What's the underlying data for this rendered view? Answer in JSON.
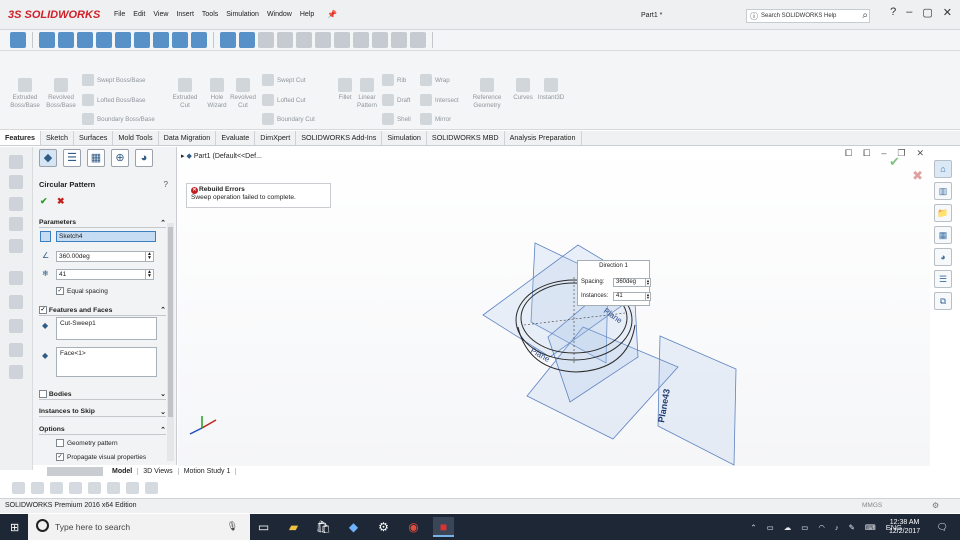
{
  "app": {
    "logo": "3S SOLIDWORKS",
    "doc_title": "Part1 *",
    "menu": [
      "File",
      "Edit",
      "View",
      "Insert",
      "Tools",
      "Simulation",
      "Window",
      "Help"
    ],
    "search_placeholder": "Search SOLIDWORKS Help",
    "status_text": "SOLIDWORKS Premium 2016 x64 Edition",
    "units": "MMGS"
  },
  "features_toolbar": {
    "items": [
      {
        "label": "Extruded\nBoss/Base",
        "icon": "extrude-boss-icon"
      },
      {
        "label": "Revolved\nBoss/Base",
        "icon": "revolve-boss-icon"
      },
      {
        "label": "Swept Boss/Base",
        "icon": "swept-boss-icon"
      },
      {
        "label": "Lofted Boss/Base",
        "icon": "lofted-boss-icon"
      },
      {
        "label": "Boundary Boss/Base",
        "icon": "boundary-boss-icon"
      },
      {
        "label": "Extruded\nCut",
        "icon": "extrude-cut-icon"
      },
      {
        "label": "Hole\nWizard",
        "icon": "hole-wizard-icon"
      },
      {
        "label": "Revolved\nCut",
        "icon": "revolve-cut-icon"
      },
      {
        "label": "Swept Cut",
        "icon": "swept-cut-icon"
      },
      {
        "label": "Lofted Cut",
        "icon": "lofted-cut-icon"
      },
      {
        "label": "Boundary Cut",
        "icon": "boundary-cut-icon"
      },
      {
        "label": "Fillet",
        "icon": "fillet-icon"
      },
      {
        "label": "Linear\nPattern",
        "icon": "linear-pattern-icon"
      },
      {
        "label": "Rib",
        "icon": "rib-icon"
      },
      {
        "label": "Draft",
        "icon": "draft-icon"
      },
      {
        "label": "Shell",
        "icon": "shell-icon"
      },
      {
        "label": "Wrap",
        "icon": "wrap-icon"
      },
      {
        "label": "Intersect",
        "icon": "intersect-icon"
      },
      {
        "label": "Mirror",
        "icon": "mirror-icon"
      },
      {
        "label": "Reference\nGeometry",
        "icon": "reference-geometry-icon"
      },
      {
        "label": "Curves",
        "icon": "curves-icon"
      },
      {
        "label": "Instant3D",
        "icon": "instant3d-icon"
      }
    ]
  },
  "tabs": [
    "Features",
    "Sketch",
    "Surfaces",
    "Mold Tools",
    "Data Migration",
    "Evaluate",
    "DimXpert",
    "SOLIDWORKS Add-Ins",
    "Simulation",
    "SOLIDWORKS MBD",
    "Analysis Preparation"
  ],
  "property_manager": {
    "title": "Circular Pattern",
    "parameters_header": "Parameters",
    "axis_value": "Sketch4",
    "angle_value": "360.00deg",
    "instances_value": "41",
    "equal_spacing_label": "Equal spacing",
    "features_header": "Features and Faces",
    "features_list": [
      "Cut-Sweep1"
    ],
    "faces_list": [
      "Face<1>"
    ],
    "bodies_label": "Bodies",
    "instances_to_skip_label": "Instances to Skip",
    "options_header": "Options",
    "geometry_pattern_label": "Geometry pattern",
    "propagate_label": "Propagate visual properties"
  },
  "bottom_tabs": [
    "Model",
    "3D Views",
    "Motion Study 1"
  ],
  "viewport": {
    "tree_item": "Part1  (Default<<Def...",
    "error_title": "Rebuild Errors",
    "error_msg": "Sweep operation failed to complete.",
    "direction_title": "Direction 1",
    "spacing_label": "Spacing:",
    "spacing_value": "360deg",
    "instances_label": "Instances:",
    "instances_value": "41",
    "plane_label": "Plane43",
    "plane_label2": "Plane",
    "plane_label3": "Plane"
  },
  "taskbar": {
    "search_placeholder": "Type here to search",
    "lang": "ENG",
    "time": "12:38 AM",
    "date": "12/2/2017"
  }
}
